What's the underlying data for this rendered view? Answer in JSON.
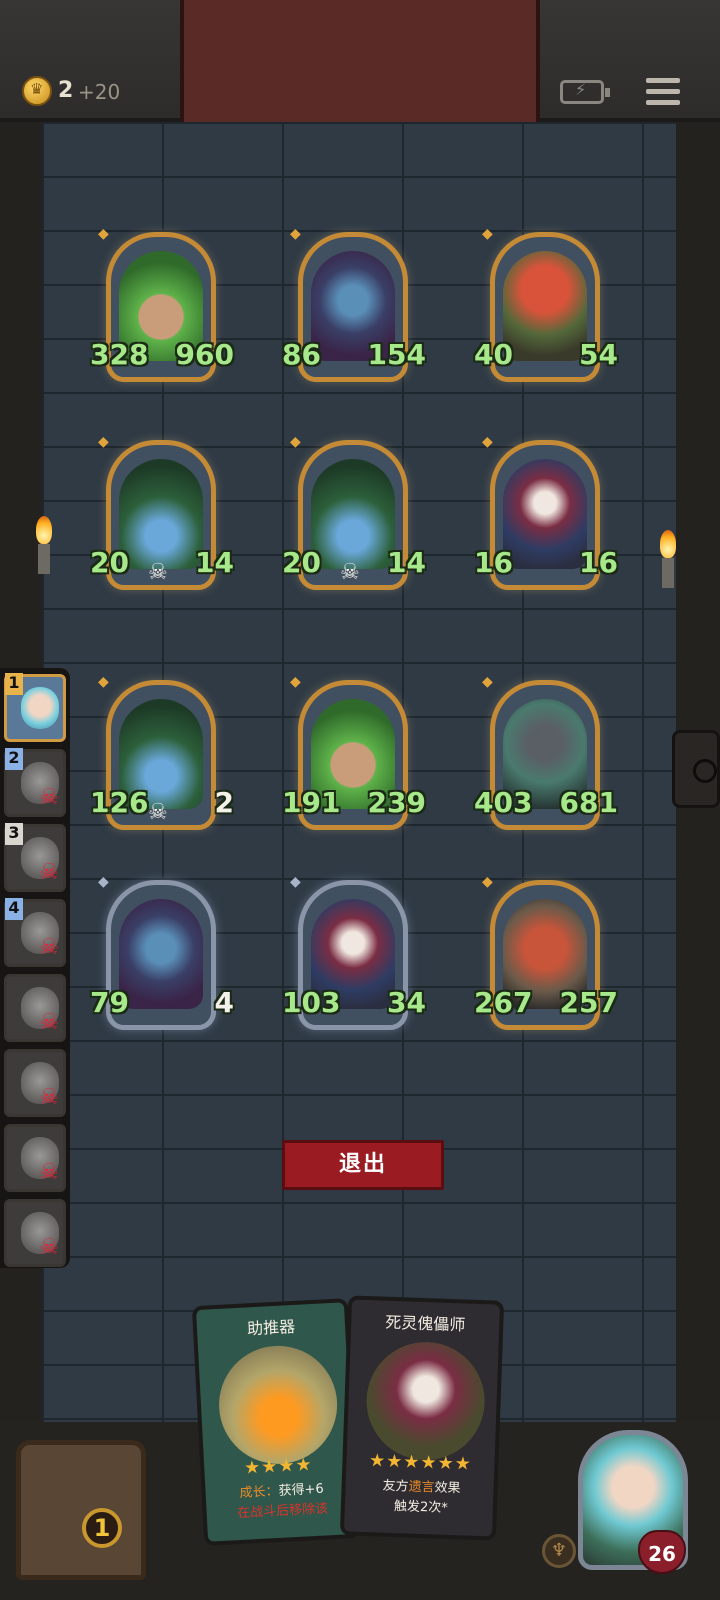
{
  "header": {
    "gold": "2",
    "gold_income": "+20",
    "battery_icon": "battery-icon",
    "menu_icon": "menu-icon"
  },
  "board": {
    "units": [
      {
        "atk": "328",
        "hp": "960",
        "type": "leaf-girl",
        "frame": "gold"
      },
      {
        "atk": "86",
        "hp": "154",
        "type": "elf-sorceress",
        "frame": "gold"
      },
      {
        "atk": "40",
        "hp": "54",
        "type": "red-demon",
        "frame": "gold"
      },
      {
        "atk": "20",
        "hp": "14",
        "type": "vine-heart",
        "frame": "gold",
        "skull": true,
        "hp_low": false
      },
      {
        "atk": "20",
        "hp": "14",
        "type": "vine-heart",
        "frame": "gold",
        "skull": true
      },
      {
        "atk": "16",
        "hp": "16",
        "type": "clown-puppet",
        "frame": "gold"
      },
      {
        "atk": "126",
        "hp": "2",
        "type": "vine-heart",
        "frame": "gold",
        "skull": true,
        "hp_low": true
      },
      {
        "atk": "191",
        "hp": "239",
        "type": "leaf-girl",
        "frame": "gold"
      },
      {
        "atk": "403",
        "hp": "681",
        "type": "iron-knight",
        "frame": "gold"
      },
      {
        "atk": "79",
        "hp": "4",
        "type": "elf-sorceress",
        "frame": "silver",
        "hp_low": true
      },
      {
        "atk": "103",
        "hp": "34",
        "type": "clown-puppet",
        "frame": "silver"
      },
      {
        "atk": "267",
        "hp": "257",
        "type": "scrap-robot",
        "frame": "gold"
      }
    ]
  },
  "queue": {
    "slots": [
      {
        "num": "1",
        "active": true,
        "color": "gold"
      },
      {
        "num": "2",
        "color": "blue"
      },
      {
        "num": "3",
        "color": "white"
      },
      {
        "num": "4",
        "color": "blue"
      },
      {
        "num": "",
        "color": "white"
      },
      {
        "num": "",
        "color": "white"
      },
      {
        "num": "",
        "color": "white"
      },
      {
        "num": "",
        "color": "white"
      }
    ]
  },
  "exit_button": {
    "label": "退出"
  },
  "chest": {
    "count": "1"
  },
  "cards": [
    {
      "title": "助推器",
      "stars": "★★★★",
      "line1_prefix": "成长：",
      "line1": "获得+6",
      "line2": "在战斗后移除该"
    },
    {
      "title": "死灵傀儡师",
      "stars": "★★★★★★",
      "line1_a": "友方",
      "line1_b": "遗言",
      "line1_c": "效果",
      "line2": "触发2次*"
    }
  ],
  "hero": {
    "hp": "26"
  },
  "colors": {
    "stat_green": "#a6e88a",
    "attack_gem": "#3c5b8e",
    "health_gem": "#9a3342",
    "exit_red": "#9a1c22",
    "frame_gold": "#c48a36",
    "frame_silver": "#8b95aa"
  }
}
